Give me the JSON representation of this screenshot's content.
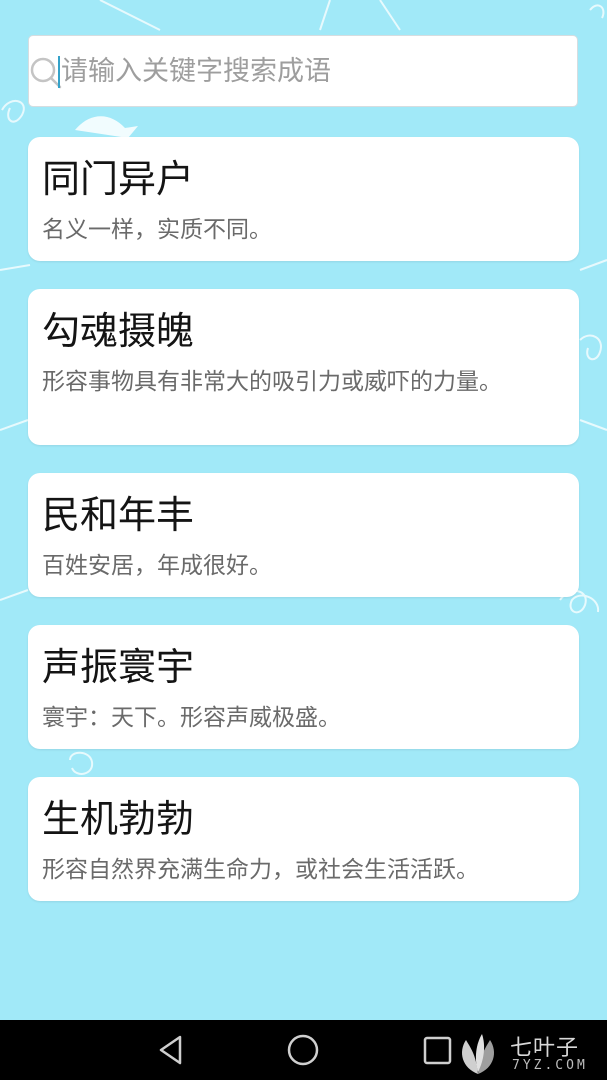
{
  "search": {
    "placeholder": "请输入关键字搜索成语",
    "value": ""
  },
  "idioms": [
    {
      "title": "同门异户",
      "description": "名义一样，实质不同。"
    },
    {
      "title": "勾魂摄魄",
      "description": "形容事物具有非常大的吸引力或威吓的力量。"
    },
    {
      "title": "民和年丰",
      "description": "百姓安居，年成很好。"
    },
    {
      "title": "声振寰宇",
      "description": "寰宇：天下。形容声威极盛。"
    },
    {
      "title": "生机勃勃",
      "description": "形容自然界充满生命力，或社会生活活跃。"
    }
  ],
  "navbar": {
    "back_icon": "back-triangle-icon",
    "home_icon": "home-circle-icon",
    "recents_icon": "recents-square-icon"
  },
  "watermark": {
    "brand": "七叶子",
    "domain": "7YZ.COM"
  },
  "colors": {
    "background": "#a1e9f8",
    "card": "#ffffff",
    "title": "#141414",
    "description": "#6a6a6a",
    "navbar": "#000000"
  }
}
